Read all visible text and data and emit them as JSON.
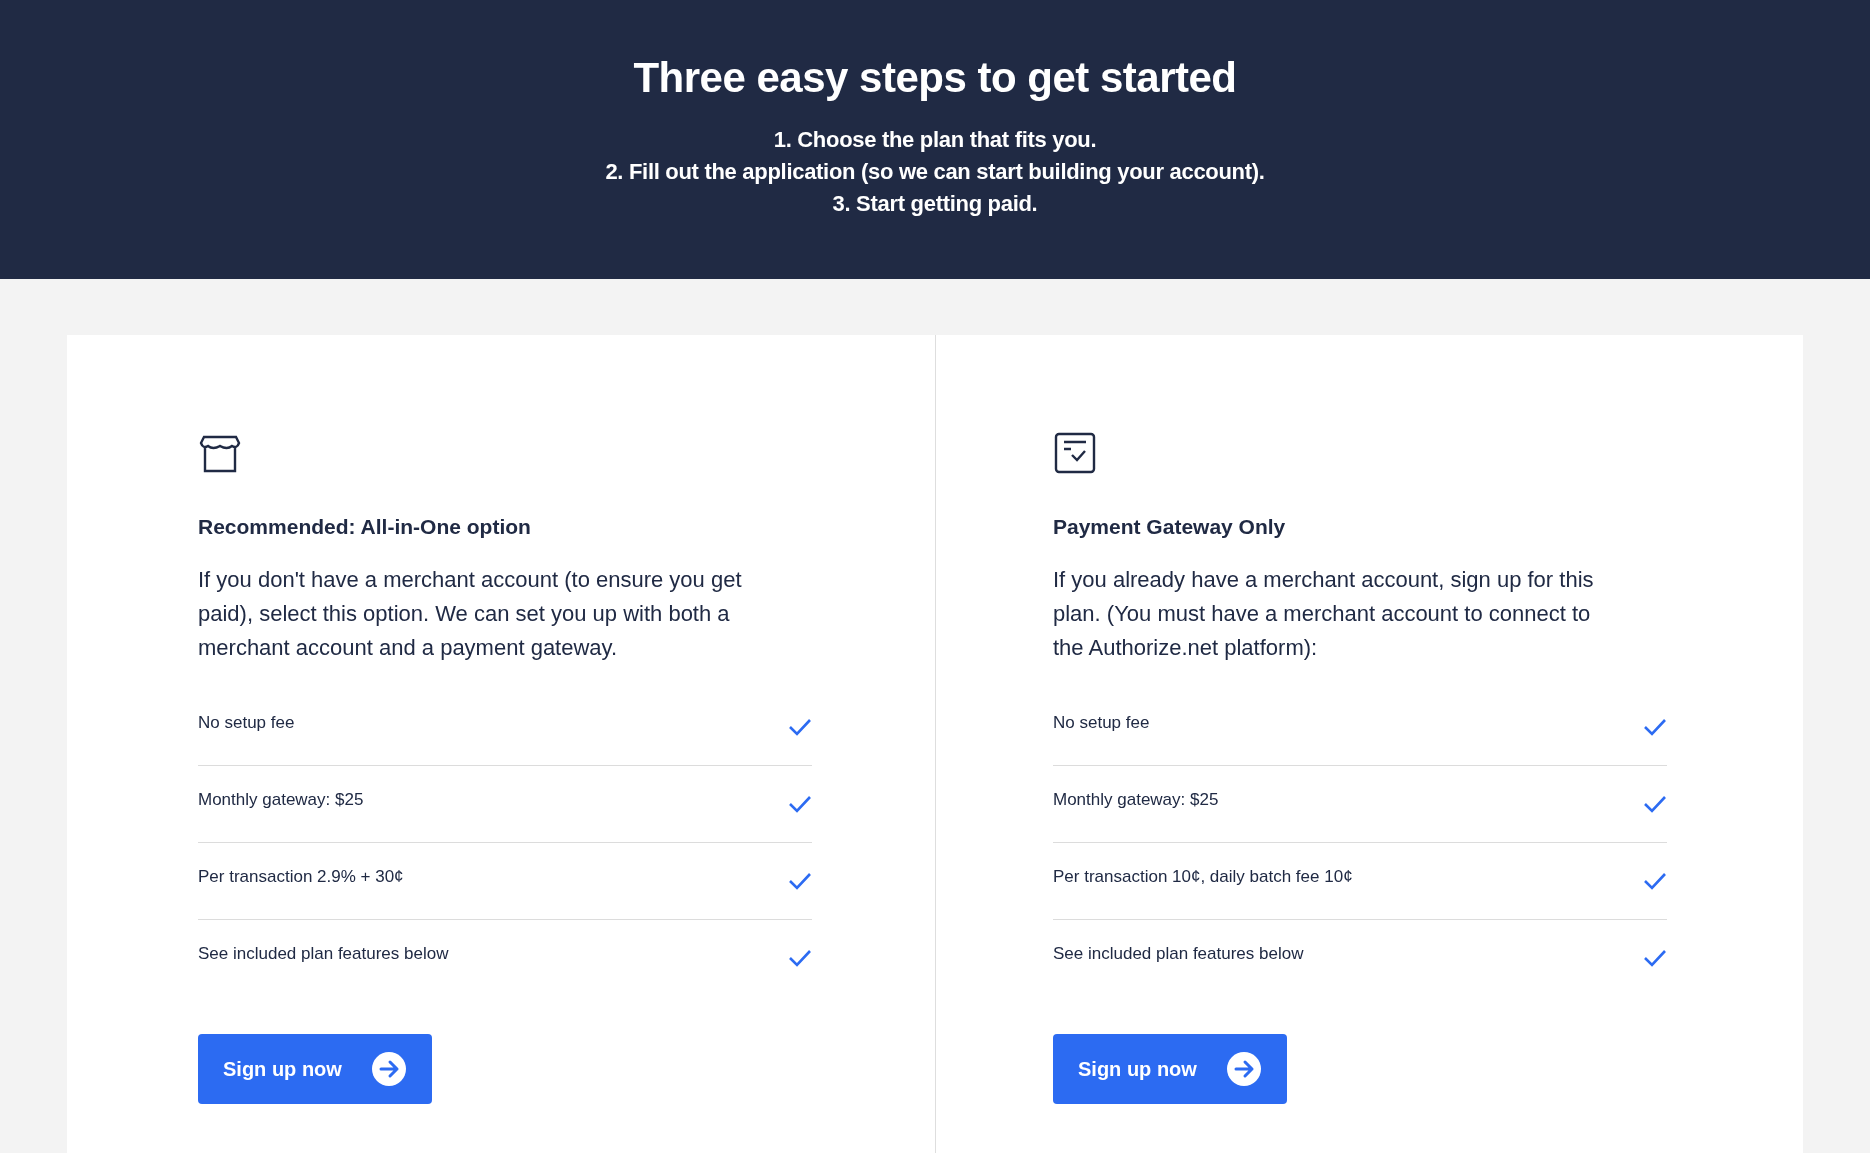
{
  "header": {
    "title": "Three easy steps to get started",
    "steps": [
      "1. Choose the plan that fits you.",
      "2. Fill out the application (so we can start building your account).",
      "3. Start getting paid."
    ]
  },
  "plans": [
    {
      "kind": "store",
      "title": "Recommended: All-in-One option",
      "description": "If you don't have a merchant account (to ensure you get paid), select this option. We can set you up with both a merchant account and a payment gateway.",
      "features": [
        "No setup fee",
        "Monthly gateway: $25",
        "Per transaction 2.9% + 30¢",
        "See included plan features below"
      ],
      "button": "Sign up now"
    },
    {
      "kind": "checklist",
      "title": "Payment Gateway Only",
      "description": "If you already have a merchant account, sign up for this plan. (You must have a merchant account to connect to the Authorize.net platform):",
      "features": [
        "No setup fee",
        "Monthly gateway: $25",
        "Per transaction 10¢, daily batch fee 10¢",
        "See included plan features below"
      ],
      "button": "Sign up now"
    }
  ]
}
